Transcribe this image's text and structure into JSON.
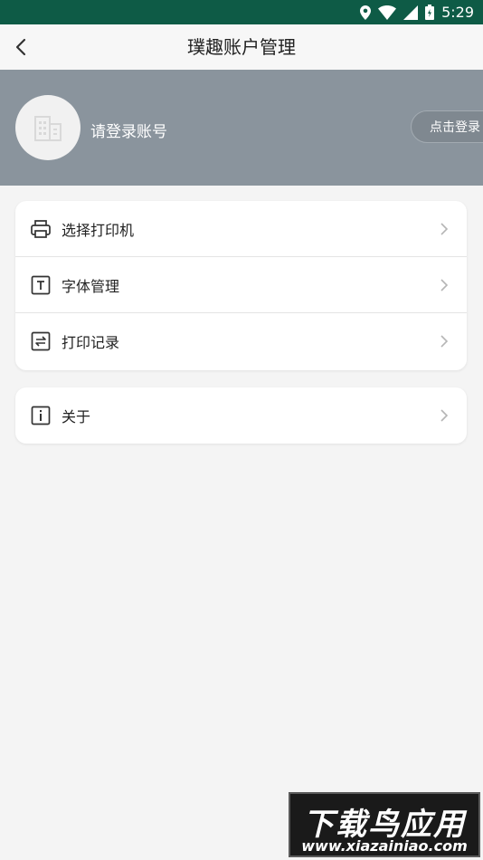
{
  "status_bar": {
    "time": "5:29"
  },
  "header": {
    "title": "璞趣账户管理"
  },
  "profile": {
    "prompt": "请登录账号",
    "login_button": "点击登录"
  },
  "menu_main": [
    {
      "label": "选择打印机",
      "icon": "printer-icon"
    },
    {
      "label": "字体管理",
      "icon": "font-icon"
    },
    {
      "label": "打印记录",
      "icon": "print-history-icon"
    }
  ],
  "menu_secondary": [
    {
      "label": "关于",
      "icon": "info-icon"
    }
  ],
  "watermark": {
    "title": "下载鸟应用",
    "url": "www.xiazainiao.com"
  },
  "colors": {
    "status_bar": "#0e5b46",
    "profile_bg": "#8a949d",
    "page_bg": "#f4f4f4"
  }
}
